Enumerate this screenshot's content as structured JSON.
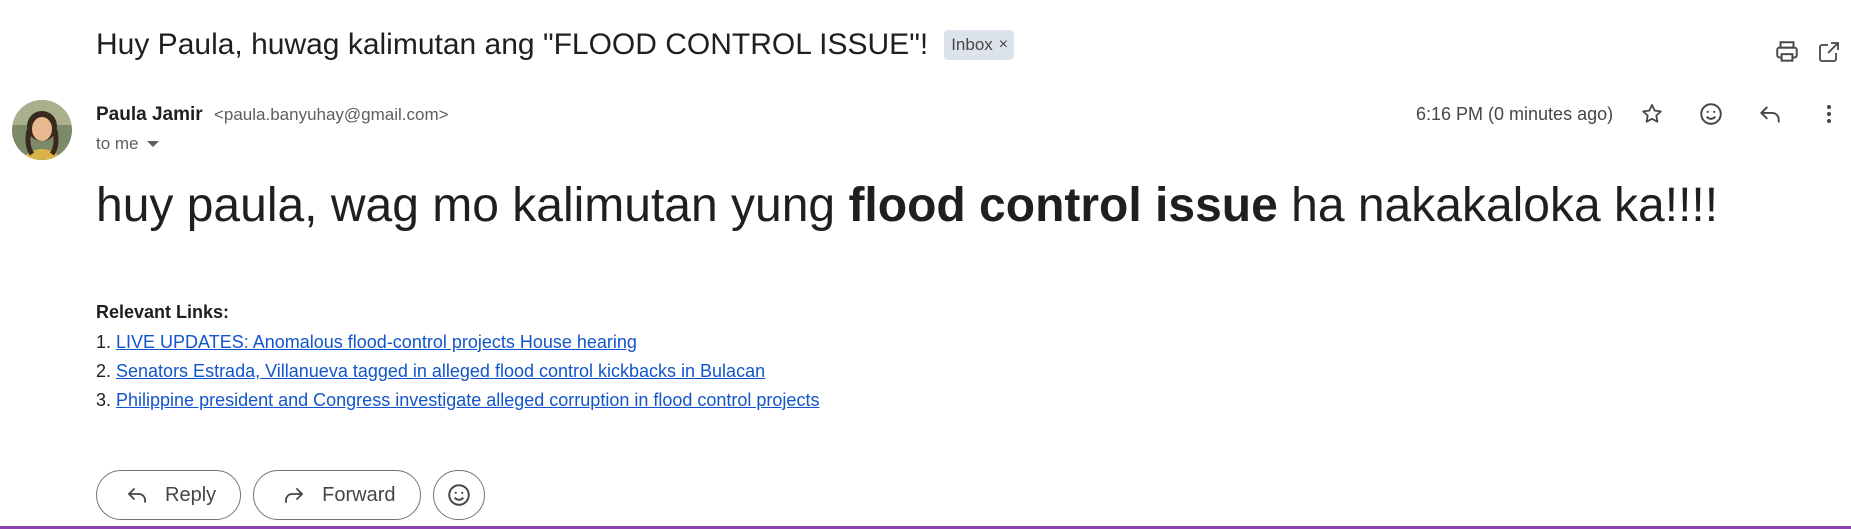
{
  "subject": {
    "title": "Huy Paula, huwag kalimutan ang \"FLOOD CONTROL ISSUE\"!",
    "label": "Inbox",
    "label_close": "×"
  },
  "top_actions": [
    "print-icon",
    "open-in-new-window-icon"
  ],
  "message": {
    "sender_name": "Paula Jamir",
    "sender_email": "<paula.banyuhay@gmail.com>",
    "recipient": "to me",
    "time": "6:16 PM (0 minutes ago)",
    "actions": [
      "star-icon",
      "emoji-reaction-icon",
      "reply-icon",
      "more-options-icon"
    ],
    "body_before": "huy paula, wag mo kalimutan yung ",
    "body_bold": "flood control issue",
    "body_after": " ha nakakaloka ka!!!!",
    "links_heading": "Relevant Links:",
    "links": [
      {
        "num": "1.",
        "text": "LIVE UPDATES: Anomalous flood-control projects House hearing"
      },
      {
        "num": "2.",
        "text": "Senators Estrada, Villanueva tagged in alleged flood control kickbacks in Bulacan"
      },
      {
        "num": "3.",
        "text": "Philippine president and Congress investigate alleged corruption in flood control projects"
      }
    ]
  },
  "reply_bar": {
    "reply_label": "Reply",
    "forward_label": "Forward"
  },
  "colors": {
    "link": "#1155cc",
    "badge_bg": "#dde3ea",
    "bottom_border": "#8e44ad"
  }
}
